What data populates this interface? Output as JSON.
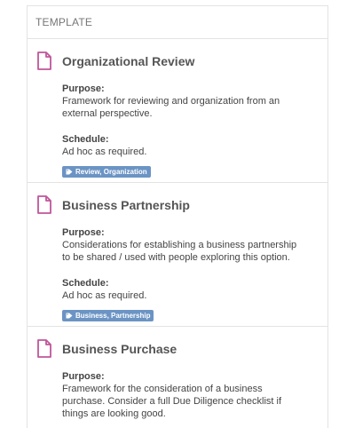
{
  "panel": {
    "header": "TEMPLATE"
  },
  "templates": [
    {
      "title": "Organizational Review",
      "purpose_label": "Purpose:",
      "purpose_lines": [
        "Framework for reviewing and organization from an",
        "external perspective."
      ],
      "schedule_label": "Schedule:",
      "schedule": "Ad hoc as required.",
      "tag": "Review, Organization"
    },
    {
      "title": "Business Partnership",
      "purpose_label": "Purpose:",
      "purpose_lines": [
        "Considerations for establishing a business partnership",
        "to be shared / used with people exploring this option."
      ],
      "schedule_label": "Schedule:",
      "schedule": "Ad hoc as required.",
      "tag": "Business, Partnership"
    },
    {
      "title": "Business Purchase",
      "purpose_label": "Purpose:",
      "purpose_lines": [
        "Framework for the consideration of a business",
        "purchase. Consider a full Due Diligence checklist if",
        "things are looking good."
      ]
    }
  ],
  "colors": {
    "icon": "#c0559a",
    "tag_bg": "#6b94c4"
  },
  "icons": {
    "document": "document-icon",
    "tag": "tag-icon"
  }
}
